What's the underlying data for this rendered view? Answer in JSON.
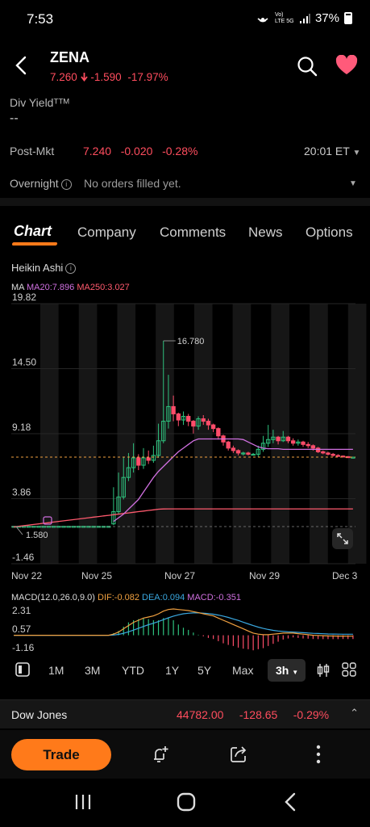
{
  "status_bar": {
    "time": "7:53",
    "network": "Vo) LTE 5G",
    "battery": "37%"
  },
  "header": {
    "ticker": "ZENA",
    "price": "7.260",
    "change": "-1.590",
    "change_pct": "-17.97%"
  },
  "div_yield": {
    "label": "Div Yieldᵀᵀᴹ",
    "value": "--"
  },
  "post_market": {
    "label": "Post-Mkt",
    "values": "7.240   -0.020   -0.28%",
    "time": "20:01 ET"
  },
  "overnight": {
    "label": "Overnight",
    "value": "No orders filled yet."
  },
  "tabs": [
    "Chart",
    "Company",
    "Comments",
    "News",
    "Options"
  ],
  "chart": {
    "type_label": "Heikin Ashi",
    "ma_label": "MA",
    "ma20": "MA20:7.896",
    "ma250": "MA250:3.027",
    "y_ticks": [
      "19.82",
      "14.50",
      "9.18",
      "3.86",
      "-1.46"
    ],
    "x_ticks": [
      "Nov 22",
      "Nov 25",
      "Nov 27",
      "Nov 29",
      "Dec 3"
    ],
    "high_label": "16.780",
    "low_label": "1.580",
    "colors": {
      "up": "#2ec27e",
      "down": "#ff4d6a",
      "ma20": "#d070e0",
      "ma250": "#ff5a6e",
      "last_price": "#f0a040"
    }
  },
  "chart_data": {
    "type": "candlestick",
    "chart_style": "Heikin Ashi",
    "ylim": [
      -1.46,
      19.82
    ],
    "y_ticks": [
      19.82,
      14.5,
      9.18,
      3.86,
      -1.46
    ],
    "x_ticks": [
      "Nov 22",
      "Nov 25",
      "Nov 27",
      "Nov 29",
      "Dec 3"
    ],
    "annotations": [
      {
        "text": "16.780"
      },
      {
        "text": "1.580"
      }
    ],
    "series": [
      {
        "name": "MA20:7.896"
      },
      {
        "name": "MA250:3.027"
      }
    ],
    "ma20": [
      null,
      null,
      null,
      null,
      null,
      null,
      null,
      null,
      null,
      null,
      null,
      null,
      null,
      null,
      null,
      null,
      null,
      null,
      null,
      null,
      2.0,
      2.3,
      2.6,
      3.0,
      3.4,
      3.8,
      4.4,
      5.0,
      5.6,
      6.1,
      6.5,
      6.9,
      7.3,
      7.7,
      8.0,
      8.3,
      8.6,
      8.75,
      8.75,
      8.75,
      8.75,
      8.75,
      8.75,
      8.75,
      8.75,
      8.75,
      8.7,
      8.5,
      8.3,
      8.1,
      8.0,
      7.95,
      7.95,
      7.95,
      7.9,
      7.9,
      7.9,
      7.9,
      7.9,
      7.9,
      7.9,
      7.9,
      7.9,
      7.9,
      7.9,
      7.9,
      7.9,
      7.9,
      7.9
    ],
    "ma250": [
      1.55,
      1.6,
      1.65,
      1.7,
      1.75,
      1.8,
      1.85,
      1.9,
      1.95,
      2.0,
      2.05,
      2.1,
      2.15,
      2.2,
      2.25,
      2.3,
      2.35,
      2.4,
      2.45,
      2.5,
      2.55,
      2.6,
      2.65,
      2.7,
      2.75,
      2.8,
      2.85,
      2.9,
      2.95,
      3.0,
      3.02,
      3.03,
      3.03,
      3.03,
      3.03,
      3.03,
      3.03,
      3.03,
      3.03,
      3.03,
      3.03,
      3.03,
      3.03,
      3.03,
      3.03,
      3.03,
      3.03,
      3.03,
      3.03,
      3.03,
      3.03,
      3.03,
      3.03,
      3.03,
      3.03,
      3.03,
      3.03,
      3.03,
      3.03,
      3.03,
      3.03,
      3.03,
      3.03,
      3.03,
      3.03,
      3.03,
      3.03,
      3.03,
      3.03
    ],
    "candles": [
      [
        1.6,
        1.6,
        1.6,
        1.6
      ],
      [
        1.6,
        1.6,
        1.6,
        1.6
      ],
      [
        1.6,
        1.6,
        1.6,
        1.6
      ],
      [
        1.6,
        1.6,
        1.6,
        1.6
      ],
      [
        1.6,
        1.6,
        1.6,
        1.6
      ],
      [
        1.6,
        1.6,
        1.6,
        1.6
      ],
      [
        1.6,
        1.6,
        1.6,
        1.6
      ],
      [
        1.6,
        1.6,
        1.6,
        1.6
      ],
      [
        1.6,
        1.6,
        1.6,
        1.6
      ],
      [
        1.6,
        1.6,
        1.6,
        1.6
      ],
      [
        1.6,
        1.6,
        1.6,
        1.6
      ],
      [
        1.6,
        1.6,
        1.6,
        1.6
      ],
      [
        1.6,
        1.6,
        1.6,
        1.6
      ],
      [
        1.6,
        1.6,
        1.6,
        1.6
      ],
      [
        1.6,
        1.6,
        1.6,
        1.6
      ],
      [
        1.6,
        1.6,
        1.6,
        1.6
      ],
      [
        1.6,
        1.6,
        1.6,
        1.6
      ],
      [
        1.6,
        1.6,
        1.6,
        1.6
      ],
      [
        1.6,
        1.6,
        1.6,
        1.6
      ],
      [
        1.6,
        1.6,
        1.6,
        1.6
      ],
      [
        1.8,
        2.8,
        4.8,
        1.7
      ],
      [
        2.8,
        4.0,
        6.0,
        2.6
      ],
      [
        4.0,
        5.6,
        7.3,
        3.8
      ],
      [
        5.6,
        6.4,
        7.6,
        5.3
      ],
      [
        6.4,
        7.2,
        8.4,
        6.0
      ],
      [
        7.2,
        6.6,
        7.5,
        6.2
      ],
      [
        6.6,
        7.2,
        8.0,
        6.3
      ],
      [
        7.2,
        7.0,
        7.8,
        6.7
      ],
      [
        7.0,
        7.4,
        8.2,
        6.8
      ],
      [
        7.4,
        8.6,
        10.0,
        7.2
      ],
      [
        8.6,
        10.2,
        16.78,
        8.4
      ],
      [
        10.2,
        11.4,
        14.0,
        9.6
      ],
      [
        11.4,
        10.8,
        12.3,
        10.2
      ],
      [
        10.8,
        10.3,
        10.9,
        9.8
      ],
      [
        10.3,
        10.6,
        11.0,
        9.9
      ],
      [
        10.6,
        10.2,
        10.8,
        9.8
      ],
      [
        10.2,
        9.8,
        10.3,
        9.2
      ],
      [
        9.8,
        10.4,
        10.6,
        9.5
      ],
      [
        10.4,
        10.2,
        10.7,
        9.9
      ],
      [
        10.2,
        9.9,
        10.4,
        9.5
      ],
      [
        9.9,
        9.6,
        10.0,
        9.3
      ],
      [
        9.6,
        9.0,
        9.7,
        8.7
      ],
      [
        9.0,
        8.5,
        9.1,
        8.2
      ],
      [
        8.5,
        8.0,
        8.6,
        7.8
      ],
      [
        8.0,
        7.8,
        8.2,
        7.6
      ],
      [
        7.8,
        7.6,
        7.9,
        7.4
      ],
      [
        7.6,
        7.6,
        7.7,
        7.4
      ],
      [
        7.6,
        7.5,
        7.7,
        7.4
      ],
      [
        7.5,
        7.5,
        7.6,
        7.4
      ],
      [
        7.5,
        7.9,
        8.2,
        7.3
      ],
      [
        7.9,
        8.4,
        9.0,
        7.7
      ],
      [
        8.4,
        8.7,
        9.9,
        8.1
      ],
      [
        8.7,
        8.9,
        9.5,
        8.4
      ],
      [
        8.9,
        8.6,
        9.0,
        8.3
      ],
      [
        8.6,
        8.9,
        9.4,
        8.5
      ],
      [
        8.9,
        8.6,
        9.0,
        8.4
      ],
      [
        8.6,
        8.4,
        8.8,
        8.2
      ],
      [
        8.4,
        8.5,
        8.7,
        8.2
      ],
      [
        8.5,
        8.3,
        8.6,
        8.1
      ],
      [
        8.3,
        8.2,
        8.5,
        8.0
      ],
      [
        8.2,
        8.0,
        8.3,
        7.8
      ],
      [
        8.0,
        7.7,
        8.1,
        7.6
      ],
      [
        7.7,
        7.6,
        7.8,
        7.5
      ],
      [
        7.6,
        7.5,
        7.7,
        7.4
      ],
      [
        7.5,
        7.4,
        7.6,
        7.3
      ],
      [
        7.4,
        7.35,
        7.5,
        7.3
      ],
      [
        7.35,
        7.3,
        7.4,
        7.26
      ],
      [
        7.3,
        7.26,
        7.35,
        7.24
      ],
      [
        7.26,
        7.26,
        7.3,
        7.24
      ]
    ],
    "last_price": 7.26,
    "macd": {
      "label": "MACD(12.0,26.0,9.0)",
      "dif_label": "DIF:-0.082",
      "dea_label": "DEA:0.094",
      "macd_label": "MACD:-0.351",
      "y_ticks": [
        2.31,
        0.57,
        -1.16
      ],
      "dif": [
        0,
        0,
        0,
        0,
        0,
        0,
        0,
        0,
        0,
        0,
        0,
        0,
        0,
        0,
        0,
        0,
        0,
        0,
        0,
        0,
        0.1,
        0.3,
        0.6,
        0.9,
        1.2,
        1.4,
        1.6,
        1.7,
        1.8,
        2.0,
        2.25,
        2.4,
        2.45,
        2.4,
        2.35,
        2.3,
        2.2,
        2.1,
        2.0,
        1.9,
        1.8,
        1.6,
        1.4,
        1.2,
        1.0,
        0.8,
        0.6,
        0.4,
        0.2,
        0.1,
        0.05,
        0.05,
        0.1,
        0.15,
        0.2,
        0.2,
        0.2,
        0.15,
        0.1,
        0.05,
        0.0,
        -0.02,
        -0.04,
        -0.06,
        -0.07,
        -0.08,
        -0.08,
        -0.082,
        -0.082
      ],
      "dea": [
        0,
        0,
        0,
        0,
        0,
        0,
        0,
        0,
        0,
        0,
        0,
        0,
        0,
        0,
        0,
        0,
        0,
        0,
        0,
        0,
        0.02,
        0.08,
        0.18,
        0.32,
        0.48,
        0.65,
        0.82,
        0.98,
        1.12,
        1.28,
        1.45,
        1.62,
        1.78,
        1.9,
        2.0,
        2.05,
        2.08,
        2.08,
        2.06,
        2.02,
        1.96,
        1.88,
        1.78,
        1.66,
        1.52,
        1.38,
        1.22,
        1.06,
        0.9,
        0.76,
        0.64,
        0.54,
        0.46,
        0.4,
        0.36,
        0.32,
        0.3,
        0.27,
        0.24,
        0.21,
        0.18,
        0.16,
        0.14,
        0.12,
        0.11,
        0.1,
        0.097,
        0.095,
        0.094
      ],
      "hist": [
        0,
        0,
        0,
        0,
        0,
        0,
        0,
        0,
        0,
        0,
        0,
        0,
        0,
        0,
        0,
        0,
        0,
        0,
        0,
        0,
        0.2,
        0.4,
        0.8,
        1.2,
        1.4,
        1.5,
        1.6,
        1.5,
        1.4,
        1.4,
        1.6,
        1.6,
        1.4,
        1.0,
        0.7,
        0.5,
        0.25,
        0.05,
        -0.1,
        -0.25,
        -0.35,
        -0.55,
        -0.75,
        -0.9,
        -1.0,
        -1.15,
        -1.25,
        -1.3,
        -1.4,
        -1.3,
        -1.2,
        -1.0,
        -0.8,
        -0.6,
        -0.4,
        -0.3,
        -0.2,
        -0.25,
        -0.3,
        -0.32,
        -0.35,
        -0.36,
        -0.36,
        -0.36,
        -0.36,
        -0.36,
        -0.35,
        -0.354,
        -0.351
      ],
      "ylim": [
        -1.16,
        2.6
      ]
    }
  },
  "periods": [
    "1M",
    "3M",
    "YTD",
    "1Y",
    "5Y",
    "Max"
  ],
  "active_period": "3h",
  "index_bar": {
    "name": "Dow Jones",
    "values": "44782.00     -128.65     -0.29%"
  },
  "actions": {
    "trade": "Trade"
  }
}
